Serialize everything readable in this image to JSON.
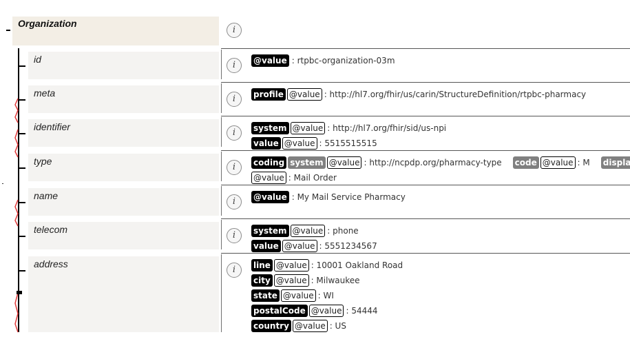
{
  "root": {
    "label": "Organization",
    "info_icon": "info-icon"
  },
  "rows": [
    {
      "name": "id",
      "lines": [
        [
          {
            "k": "tag",
            "t": "@value"
          },
          {
            "k": "val",
            "t": ": rtpbc-organization-03m"
          }
        ]
      ]
    },
    {
      "name": "meta",
      "lines": [
        [
          {
            "k": "tag",
            "t": "profile"
          },
          {
            "k": "vtag",
            "t": "@value"
          },
          {
            "k": "val",
            "t": ": http://hl7.org/fhir/us/carin/StructureDefinition/rtpbc-pharmacy"
          }
        ]
      ]
    },
    {
      "name": "identifier",
      "lines": [
        [
          {
            "k": "tag",
            "t": "system"
          },
          {
            "k": "vtag",
            "t": "@value"
          },
          {
            "k": "val",
            "t": ": http://hl7.org/fhir/sid/us-npi"
          }
        ],
        [
          {
            "k": "tag",
            "t": "value"
          },
          {
            "k": "vtag",
            "t": "@value"
          },
          {
            "k": "val",
            "t": ": 5515515515"
          }
        ]
      ]
    },
    {
      "name": "type",
      "lines": [
        [
          {
            "k": "tag",
            "t": "coding"
          },
          {
            "k": "gtag",
            "t": "system"
          },
          {
            "k": "vtag",
            "t": "@value"
          },
          {
            "k": "val",
            "t": ": http://ncpdp.org/pharmacy-type"
          },
          {
            "k": "gap"
          },
          {
            "k": "gtag",
            "t": "code"
          },
          {
            "k": "vtag",
            "t": "@value"
          },
          {
            "k": "val",
            "t": ": M"
          },
          {
            "k": "gap"
          },
          {
            "k": "gtag",
            "t": "display"
          }
        ],
        [
          {
            "k": "vtag",
            "t": "@value"
          },
          {
            "k": "val",
            "t": ": Mail Order"
          }
        ]
      ]
    },
    {
      "name": "name",
      "lines": [
        [
          {
            "k": "tag",
            "t": "@value"
          },
          {
            "k": "val",
            "t": ": My Mail Service Pharmacy"
          }
        ]
      ]
    },
    {
      "name": "telecom",
      "lines": [
        [
          {
            "k": "tag",
            "t": "system"
          },
          {
            "k": "vtag",
            "t": "@value"
          },
          {
            "k": "val",
            "t": ": phone"
          }
        ],
        [
          {
            "k": "tag",
            "t": "value"
          },
          {
            "k": "vtag",
            "t": "@value"
          },
          {
            "k": "val",
            "t": ": 5551234567"
          }
        ]
      ]
    },
    {
      "name": "address",
      "lines": [
        [
          {
            "k": "tag",
            "t": "line"
          },
          {
            "k": "vtag",
            "t": "@value"
          },
          {
            "k": "val",
            "t": ": 10001 Oakland Road"
          }
        ],
        [
          {
            "k": "tag",
            "t": "city"
          },
          {
            "k": "vtag",
            "t": "@value"
          },
          {
            "k": "val",
            "t": ": Milwaukee"
          }
        ],
        [
          {
            "k": "tag",
            "t": "state"
          },
          {
            "k": "vtag",
            "t": "@value"
          },
          {
            "k": "val",
            "t": ": WI"
          }
        ],
        [
          {
            "k": "tag",
            "t": "postalCode"
          },
          {
            "k": "vtag",
            "t": "@value"
          },
          {
            "k": "val",
            "t": ": 54444"
          }
        ],
        [
          {
            "k": "tag",
            "t": "country"
          },
          {
            "k": "vtag",
            "t": "@value"
          },
          {
            "k": "val",
            "t": ": US"
          }
        ]
      ]
    }
  ],
  "info_glyph": "i",
  "colors": {
    "tag": "#000000",
    "gray_tag": "#808080",
    "tree_red": "#e23b3b",
    "name_bg": "#f4f3f1",
    "root_bg": "#f3eee5"
  }
}
